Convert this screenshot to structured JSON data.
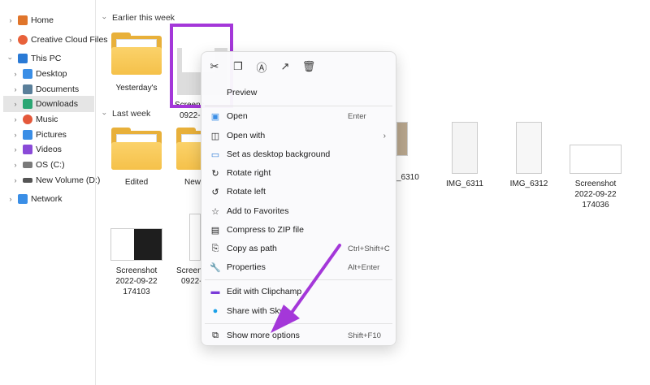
{
  "sidebar": {
    "items": [
      {
        "label": "Home",
        "icon": "home-icon",
        "color": "#e0752b"
      },
      {
        "label": "Creative Cloud Files",
        "icon": "creative-cloud-icon",
        "color": "#e8613a"
      },
      {
        "label": "This PC",
        "icon": "pc-icon",
        "color": "#2a7ad5"
      },
      {
        "label": "Desktop",
        "icon": "desktop-icon",
        "color": "#3a8ee6"
      },
      {
        "label": "Documents",
        "icon": "documents-icon",
        "color": "#5a7f9a"
      },
      {
        "label": "Downloads",
        "icon": "downloads-icon",
        "color": "#2aa673"
      },
      {
        "label": "Music",
        "icon": "music-icon",
        "color": "#e4583a"
      },
      {
        "label": "Pictures",
        "icon": "pictures-icon",
        "color": "#3a8ee6"
      },
      {
        "label": "Videos",
        "icon": "videos-icon",
        "color": "#8a4ad8"
      },
      {
        "label": "OS (C:)",
        "icon": "drive-icon",
        "color": "#7a7a7a"
      },
      {
        "label": "New Volume (D:)",
        "icon": "drive-icon",
        "color": "#555555"
      },
      {
        "label": "Network",
        "icon": "network-icon",
        "color": "#3a8ee6"
      }
    ],
    "selected": "Downloads"
  },
  "sections": {
    "earlier_label": "Earlier this week",
    "last_week_label": "Last week"
  },
  "files": {
    "yesterdays": "Yesterday's",
    "screenshot_partial_1": "Screens",
    "screenshot_partial_2": "0922-",
    "edited": "Edited",
    "new_partial": "New",
    "img_6310": "_6310",
    "img_6311": "IMG_6311",
    "img_6312": "IMG_6312",
    "screenshot_174036": [
      "Screenshot",
      "2022-09-22",
      "174036"
    ],
    "screenshot_174103": [
      "Screenshot",
      "2022-09-22",
      "174103"
    ],
    "screenshot_partial_3a": "Screens",
    "screenshot_partial_3b": "0922-"
  },
  "context_menu": {
    "top_icons": [
      "cut-icon",
      "copy-icon",
      "rename-icon",
      "share-icon",
      "delete-icon"
    ],
    "preview": "Preview",
    "items": [
      {
        "label": "Open",
        "shortcut": "Enter",
        "icon": "open-icon"
      },
      {
        "label": "Open with",
        "shortcut": "",
        "icon": "open-with-icon",
        "submenu": "›"
      },
      {
        "label": "Set as desktop background",
        "shortcut": "",
        "icon": "desktop-background-icon"
      },
      {
        "label": "Rotate right",
        "shortcut": "",
        "icon": "rotate-right-icon"
      },
      {
        "label": "Rotate left",
        "shortcut": "",
        "icon": "rotate-left-icon"
      },
      {
        "label": "Add to Favorites",
        "shortcut": "",
        "icon": "star-icon"
      },
      {
        "label": "Compress to ZIP file",
        "shortcut": "",
        "icon": "zip-icon"
      },
      {
        "label": "Copy as path",
        "shortcut": "Ctrl+Shift+C",
        "icon": "copy-path-icon"
      },
      {
        "label": "Properties",
        "shortcut": "Alt+Enter",
        "icon": "properties-icon"
      },
      {
        "label": "Edit with Clipchamp",
        "shortcut": "",
        "icon": "clipchamp-icon"
      },
      {
        "label": "Share with Sky",
        "shortcut": "",
        "icon": "skype-icon"
      },
      {
        "label": "Show more options",
        "shortcut": "Shift+F10",
        "icon": "more-options-icon"
      }
    ]
  },
  "colors": {
    "selection_border": "#a437d9",
    "arrow": "#a437d9",
    "folder": "#f5c14a"
  }
}
